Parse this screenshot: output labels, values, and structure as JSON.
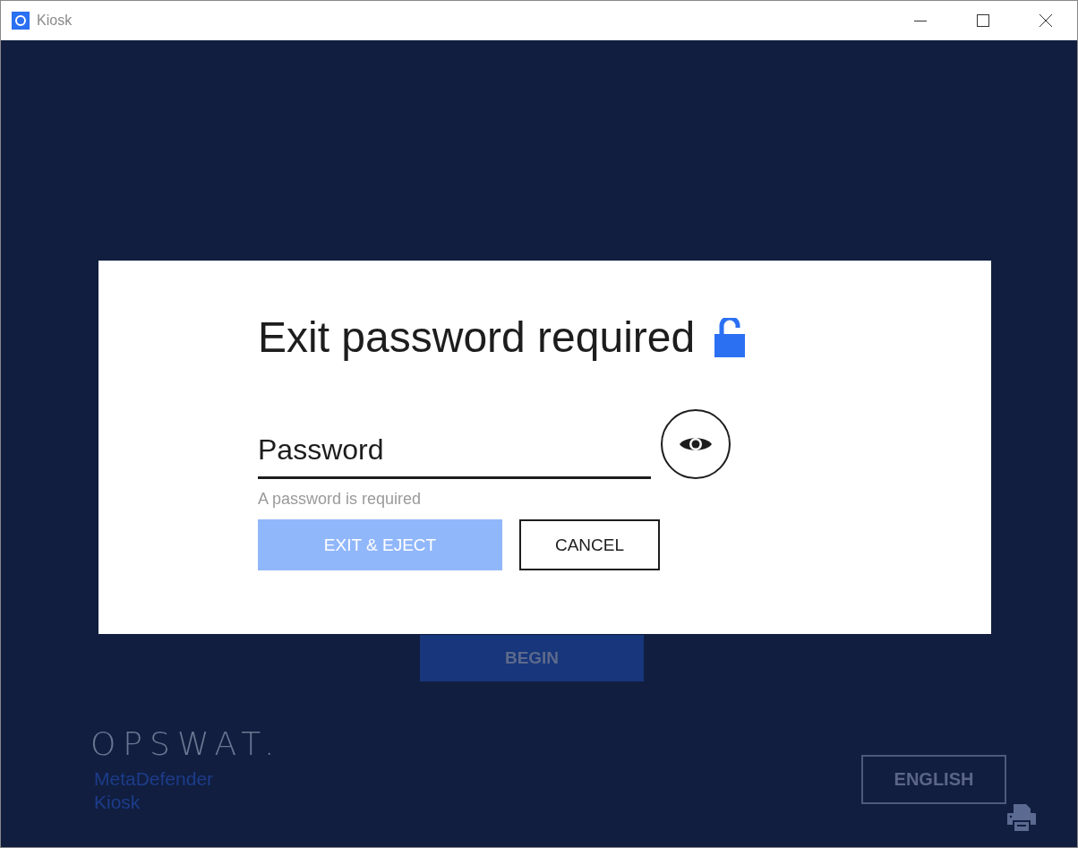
{
  "window": {
    "title": "Kiosk"
  },
  "background": {
    "begin_button": {
      "label": "BEGIN"
    },
    "logo": {
      "wordmark": "OPSWAT.",
      "product_lines": [
        "MetaDefender",
        "Kiosk"
      ]
    },
    "language_button": {
      "label": "ENGLISH"
    }
  },
  "dialog": {
    "title": "Exit password required",
    "password_field": {
      "placeholder": "Password"
    },
    "error": "A password is required",
    "buttons": [
      {
        "label": "EXIT & EJECT",
        "kind": "primary",
        "disabled": true
      },
      {
        "label": "CANCEL",
        "kind": "outline",
        "disabled": false
      }
    ]
  }
}
